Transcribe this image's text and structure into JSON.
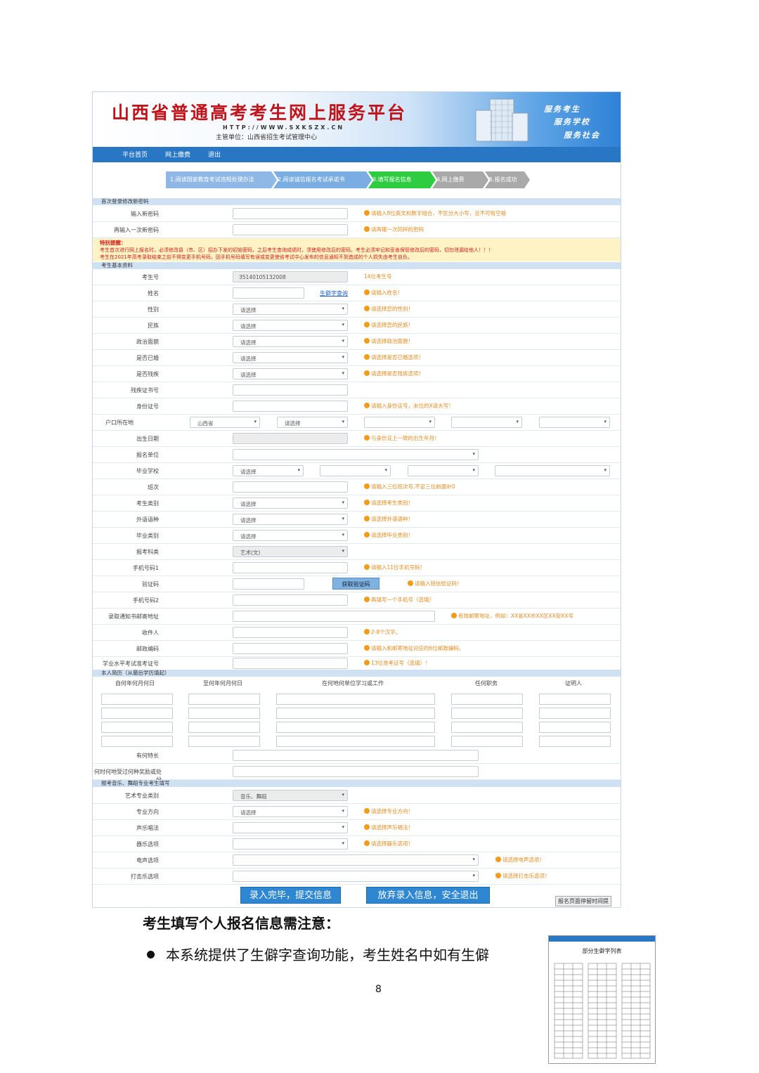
{
  "banner": {
    "title": "山西省普通高考考生网上服务平台",
    "url": "HTTP://WWW.SXKSZX.CN",
    "sponsor": "主管单位：山西省招生考试管理中心",
    "slogans": [
      "服务考生",
      "服务学校",
      "服务社会"
    ]
  },
  "nav": [
    "平台首页",
    "网上缴费",
    "退出"
  ],
  "steps": [
    {
      "label": "1.阅读国家教育考试违规处理办法",
      "color": "#8fb8e6"
    },
    {
      "label": "2.阅读诚信报名考试承诺书",
      "color": "#7aaee3"
    },
    {
      "label": "3.填写报名信息",
      "color": "#2ecc40"
    },
    {
      "label": "4.网上缴费",
      "color": "#a9a9a9"
    },
    {
      "label": "5.报名成功",
      "color": "#a9a9a9"
    }
  ],
  "password_section": {
    "title": "首次登录修改新密码",
    "rows": [
      {
        "label": "输入新密码",
        "hint": "请输入8位英文和数字组合，不区分大小写，且不可有空格"
      },
      {
        "label": "再输入一次新密码",
        "hint": "请再输一次同样的密码"
      }
    ]
  },
  "warning": {
    "title": "特别提醒：",
    "line1": "考生首次进行网上报名时，必须修改县（市、区）招办下发的初始密码，之后考生查询成绩时，须使用修改后的密码。考生必须牢记和妥善保管修改后的密码，切勿泄漏给他人！！！",
    "line2": "考生在2021年高考录取结束之前不得变更手机号码，因手机号码填写有误或变更使省考试中心发布的信息通知不到造成的个人损失由考生自负。"
  },
  "basic_section": {
    "title": "考生基本资料",
    "exam_no": {
      "label": "考生号",
      "value": "35140105132008",
      "hint": "14位考生号"
    },
    "name": {
      "label": "姓名",
      "link": "生僻字查询",
      "hint": "请输入姓名！"
    },
    "gender": {
      "label": "性别",
      "value": "请选择",
      "hint": "请选择您的性别！"
    },
    "ethnicity": {
      "label": "民族",
      "value": "请选择",
      "hint": "请选择您的民族！"
    },
    "politics": {
      "label": "政治面貌",
      "value": "请选择",
      "hint": "请选择政治面貌！"
    },
    "married": {
      "label": "是否已婚",
      "value": "请选择",
      "hint": "请选择是否已婚选项！"
    },
    "disabled": {
      "label": "是否残疾",
      "value": "请选择",
      "hint": "请选择是否残疾选项！"
    },
    "disability_cert": {
      "label": "残疾证书号"
    },
    "id_no": {
      "label": "身份证号",
      "hint": "请输入身份证号，末位的X请大写！"
    },
    "hukou": {
      "label": "户口所在地",
      "province": "山西省",
      "city": "请选择"
    },
    "birth": {
      "label": "出生日期",
      "hint": "与身份证上一致的出生年月！"
    },
    "unit": {
      "label": "报名单位"
    },
    "school": {
      "label": "毕业学校",
      "value": "请选择"
    },
    "class": {
      "label": "班次",
      "hint": "请输入三位班次号,不足三位前面补0"
    },
    "category": {
      "label": "考生类别",
      "value": "请选择",
      "hint": "请选择考生类别！"
    },
    "language": {
      "label": "外语语种",
      "value": "请选择",
      "hint": "请选择外语语种！"
    },
    "grad_type": {
      "label": "毕业类别",
      "value": "请选择",
      "hint": "请选择毕业类别！"
    },
    "subject": {
      "label": "报考科类",
      "value": "艺术(文)"
    },
    "phone1": {
      "label": "手机号码1",
      "hint": "请输入11位手机号码！"
    },
    "code": {
      "label": "验证码",
      "button": "获取验证码",
      "hint": "请输入短信验证码！"
    },
    "phone2": {
      "label": "手机号码2",
      "hint": "再填写一个手机号（选填）"
    },
    "address": {
      "label": "录取通知书邮寄地址",
      "hint": "有效邮寄地址，例如：XX省XX市XX区XX街XX号"
    },
    "recipient": {
      "label": "收件人",
      "hint": "2-8个汉字。"
    },
    "postcode": {
      "label": "邮政编码",
      "hint": "请输入和邮寄地址对应的6位邮政编码。"
    },
    "xueye_no": {
      "label": "学业水平考试准考证号",
      "hint": "13位准考证号（选填）！"
    }
  },
  "resume_section": {
    "title": "本人简历（从最后学历填起）",
    "columns": [
      "自何年何月何日",
      "至何年何月何日",
      "在何地何单位学习或工作",
      "任何职务",
      "证明人"
    ],
    "specialty_label": "有何特长",
    "award_label": "何时何地受过何种奖励或处分"
  },
  "art_section": {
    "title": "报考音乐、舞蹈专业考生填写",
    "art_type": {
      "label": "艺术专业类别",
      "value": "音乐、舞蹈"
    },
    "direction": {
      "label": "专业方向",
      "value": "请选择",
      "hint": "请选择专业方向！"
    },
    "vocal": {
      "label": "声乐唱法",
      "hint": "请选择声乐唱法！"
    },
    "instrument": {
      "label": "器乐选项",
      "hint": "请选择器乐选项！"
    },
    "electric": {
      "label": "电声选项",
      "hint": "请选择电声选项！"
    },
    "percussion": {
      "label": "打击乐选项",
      "hint": "请选择打击乐选项！"
    }
  },
  "buttons": {
    "submit": "录入完毕，提交信息",
    "cancel": "放弃录入信息，安全退出"
  },
  "stay_tip": "报名页面停留时间提",
  "doc": {
    "note_heading": "考生填写个人报名信息需注意：",
    "bullet": "本系统提供了生僻字查询功能，考生姓名中如有生僻",
    "page_number": "8",
    "thumbnail_title": "部分生僻字列表"
  }
}
